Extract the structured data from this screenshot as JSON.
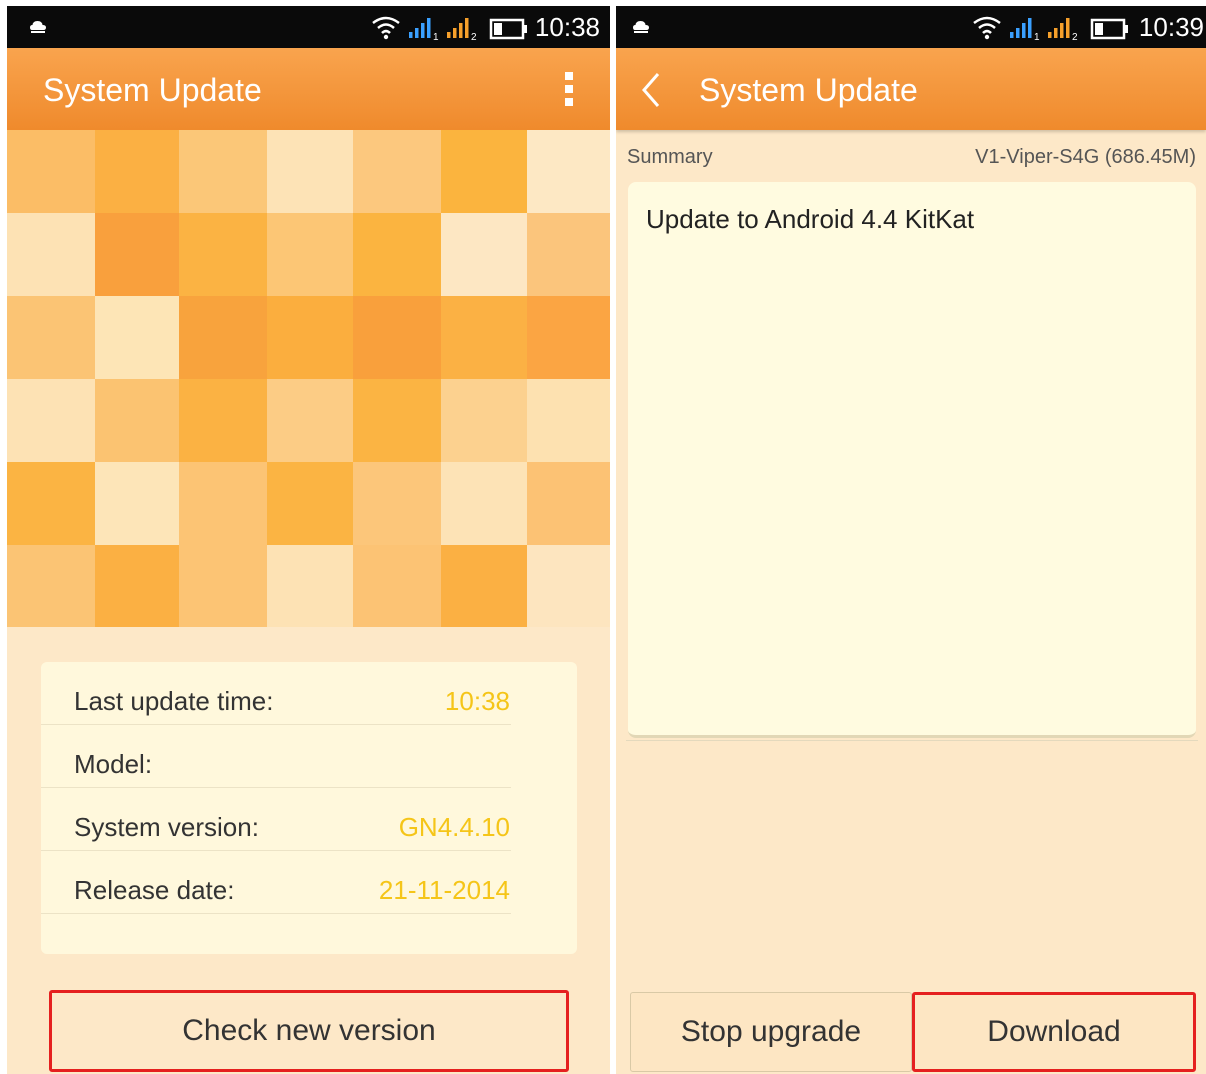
{
  "left": {
    "status_time": "10:38",
    "title": "System Update",
    "info": [
      {
        "label": "Last update time:",
        "value": "10:38"
      },
      {
        "label": "Model:",
        "value": ""
      },
      {
        "label": "System version:",
        "value": "GN4.4.10"
      },
      {
        "label": "Release date:",
        "value": "21-11-2014"
      }
    ],
    "check_button": "Check new version"
  },
  "right": {
    "status_time": "10:39",
    "title": "System Update",
    "summary_label": "Summary",
    "package": "V1-Viper-S4G (686.45M)",
    "summary_text": "Update to Android 4.4 KitKat",
    "stop_button": "Stop upgrade",
    "download_button": "Download"
  },
  "colors": {
    "appbar": "#f29432",
    "accent_value": "#f5c518",
    "highlight": "#e5201f",
    "background": "#fde8c8"
  },
  "mosaic_colors": [
    [
      "#fbbd66",
      "#fbb043",
      "#fbc778",
      "#fde3b6",
      "#fcc87e",
      "#fbb43e",
      "#fde8c4"
    ],
    [
      "#fde2b4",
      "#f9a03d",
      "#fbb343",
      "#fcc675",
      "#fbb440",
      "#fde7c3",
      "#fbc57c"
    ],
    [
      "#fbc474",
      "#fde5b6",
      "#f8a33d",
      "#fbae3e",
      "#f9a03c",
      "#fbb144",
      "#fba543"
    ],
    [
      "#fde2b4",
      "#fbc371",
      "#fbb243",
      "#fccc85",
      "#fbb443",
      "#fcd18f",
      "#fde1b0"
    ],
    [
      "#fbb443",
      "#fde5b8",
      "#fcc474",
      "#fbb443",
      "#fcc67a",
      "#fde3b6",
      "#fcc274"
    ],
    [
      "#fbc474",
      "#fbb043",
      "#fcc474",
      "#fde2b4",
      "#fcc374",
      "#fbb043",
      "#fde5bf"
    ]
  ]
}
